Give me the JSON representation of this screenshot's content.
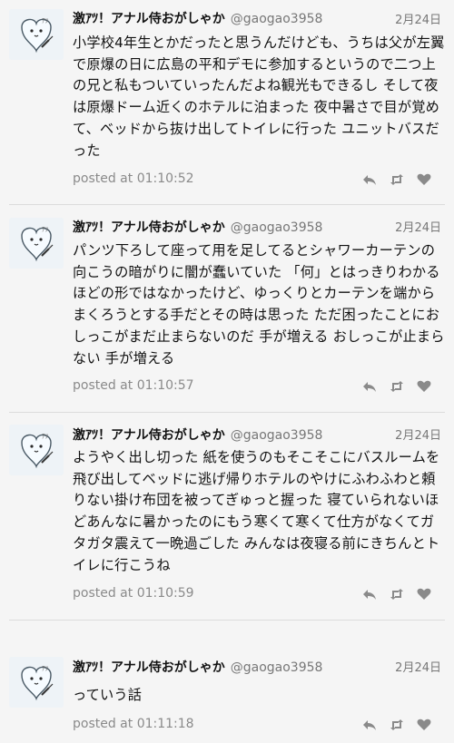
{
  "tweets": [
    {
      "display_name": "激ｱﾂ！アナル侍おがしゃか",
      "handle": "@gaogao3958",
      "date": "2月24日",
      "text": "小学校4年生とかだったと思うんだけども、うちは父が左翼で原爆の日に広島の平和デモに参加するというので二つ上の兄と私もついていったんだよね観光もできるし そして夜は原爆ドーム近くのホテルに泊まった 夜中暑さで目が覚めて、ベッドから抜け出してトイレに行った ユニットバスだった",
      "posted": "posted at 01:10:52"
    },
    {
      "display_name": "激ｱﾂ！アナル侍おがしゃか",
      "handle": "@gaogao3958",
      "date": "2月24日",
      "text": "パンツ下ろして座って用を足してるとシャワーカーテンの向こうの暗がりに闇が蠢いていた 「何」とはっきりわかるほどの形ではなかったけど、ゆっくりとカーテンを端からまくろうとする手だとその時は思った ただ困ったことにおしっこがまだ止まらないのだ 手が増える おしっこが止まらない 手が増える",
      "posted": "posted at 01:10:57"
    },
    {
      "display_name": "激ｱﾂ！アナル侍おがしゃか",
      "handle": "@gaogao3958",
      "date": "2月24日",
      "text": "ようやく出し切った 紙を使うのもそこそこにバスルームを飛び出してベッドに逃げ帰りホテルのやけにふわふわと頼りない掛け布団を被ってぎゅっと握った 寝ていられないほどあんなに暑かったのにもう寒くて寒くて仕方がなくてガタガタ震えて一晩過ごした みんなは夜寝る前にきちんとトイレに行こうね",
      "posted": "posted at 01:10:59"
    },
    {
      "display_name": "激ｱﾂ！アナル侍おがしゃか",
      "handle": "@gaogao3958",
      "date": "2月24日",
      "text": "っていう話",
      "posted": "posted at 01:11:18"
    }
  ],
  "icons": {
    "reply": "reply-icon",
    "retweet": "retweet-icon",
    "like": "heart-icon"
  },
  "colors": {
    "background": "#f5f5f5",
    "text": "#111111",
    "muted": "#777777",
    "icon": "#8a8a8a"
  }
}
